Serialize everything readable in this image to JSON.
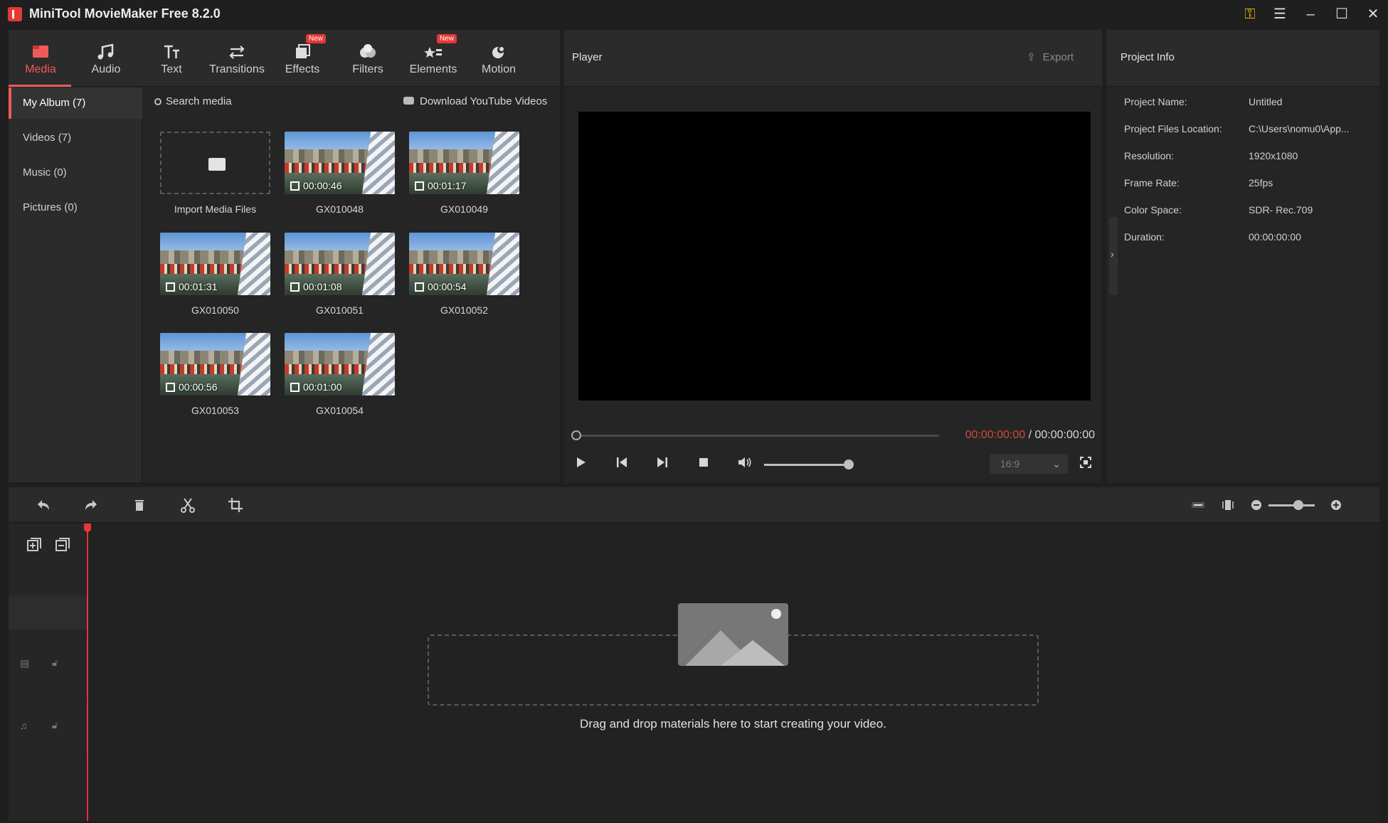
{
  "app": {
    "title": "MiniTool MovieMaker Free 8.2.0",
    "accent": "#e53935"
  },
  "window_controls": {
    "key_icon": "key-icon",
    "menu_icon": "hamburger-menu-icon",
    "minimize_icon": "minimize-icon",
    "maximize_icon": "maximize-icon",
    "close_icon": "close-icon"
  },
  "toolbar": {
    "tabs": [
      {
        "label": "Media",
        "icon": "media-icon",
        "active": true
      },
      {
        "label": "Audio",
        "icon": "music-note-icon"
      },
      {
        "label": "Text",
        "icon": "text-icon"
      },
      {
        "label": "Transitions",
        "icon": "transitions-icon"
      },
      {
        "label": "Effects",
        "icon": "effects-icon",
        "badge": "New"
      },
      {
        "label": "Filters",
        "icon": "filters-icon"
      },
      {
        "label": "Elements",
        "icon": "elements-icon",
        "badge": "New"
      },
      {
        "label": "Motion",
        "icon": "motion-icon"
      }
    ]
  },
  "sidebar": {
    "items": [
      {
        "label": "My Album (7)",
        "active": true
      },
      {
        "label": "Videos (7)"
      },
      {
        "label": "Music (0)"
      },
      {
        "label": "Pictures (0)"
      }
    ]
  },
  "media": {
    "search_label": "Search media",
    "youtube_label": "Download YouTube Videos",
    "import_label": "Import Media Files",
    "items": [
      {
        "name": "GX010048",
        "duration": "00:00:46"
      },
      {
        "name": "GX010049",
        "duration": "00:01:17"
      },
      {
        "name": "GX010050",
        "duration": "00:01:31"
      },
      {
        "name": "GX010051",
        "duration": "00:01:08"
      },
      {
        "name": "GX010052",
        "duration": "00:00:54"
      },
      {
        "name": "GX010053",
        "duration": "00:00:56"
      },
      {
        "name": "GX010054",
        "duration": "00:01:00"
      }
    ]
  },
  "player": {
    "title": "Player",
    "export_label": "Export",
    "time_current": "00:00:00:00",
    "time_separator": " / ",
    "time_total": "00:00:00:00",
    "aspect_ratio": "16:9",
    "progress": 0,
    "volume": 0.8
  },
  "project_info": {
    "title": "Project Info",
    "rows": [
      {
        "key": "Project Name:",
        "value": "Untitled"
      },
      {
        "key": "Project Files Location:",
        "value": "C:\\Users\\nomu0\\App..."
      },
      {
        "key": "Resolution:",
        "value": "1920x1080"
      },
      {
        "key": "Frame Rate:",
        "value": "25fps"
      },
      {
        "key": "Color Space:",
        "value": "SDR- Rec.709"
      },
      {
        "key": "Duration:",
        "value": "00:00:00:00"
      }
    ]
  },
  "timeline": {
    "drop_text": "Drag and drop materials here to start creating your video.",
    "zoom": 0.55
  }
}
